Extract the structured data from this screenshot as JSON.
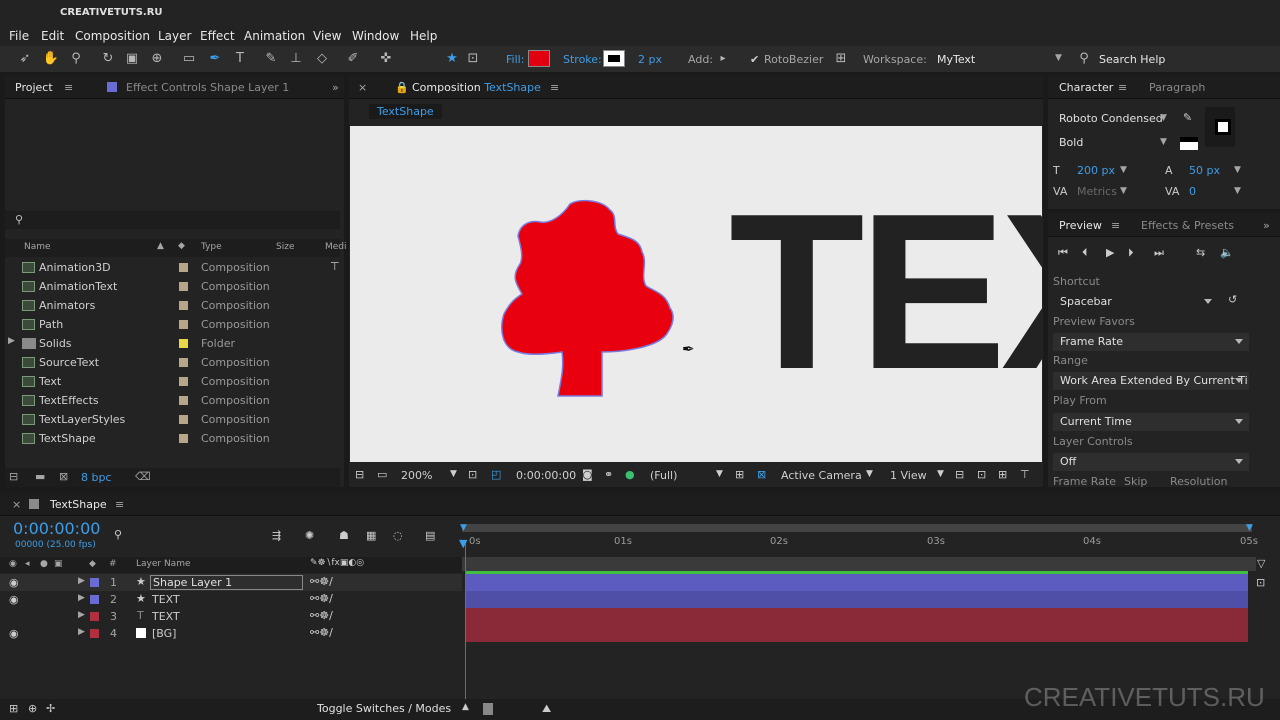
{
  "app": {
    "title": "CREATIVETUTS.RU",
    "watermark": "CREATIVETUTS.RU"
  },
  "menu": [
    "File",
    "Edit",
    "Composition",
    "Layer",
    "Effect",
    "Animation",
    "View",
    "Window",
    "Help"
  ],
  "toolbar": {
    "fill_label": "Fill:",
    "fill_color": "#e00010",
    "stroke_label": "Stroke:",
    "stroke_width": "2 px",
    "add_label": "Add:",
    "rotobezier_label": "RotoBezier",
    "workspace_label": "Workspace:",
    "workspace_value": "MyText",
    "search_placeholder": "Search Help"
  },
  "project": {
    "tab": "Project",
    "effect_tab": "Effect Controls Shape Layer 1",
    "search_icon": "search-icon",
    "columns": [
      "Name",
      "Type",
      "Size",
      "Medi"
    ],
    "items": [
      {
        "name": "Animation3D",
        "type": "Composition"
      },
      {
        "name": "AnimationText",
        "type": "Composition"
      },
      {
        "name": "Animators",
        "type": "Composition"
      },
      {
        "name": "Path",
        "type": "Composition"
      },
      {
        "name": "Solids",
        "type": "Folder"
      },
      {
        "name": "SourceText",
        "type": "Composition"
      },
      {
        "name": "Text",
        "type": "Composition"
      },
      {
        "name": "TextEffects",
        "type": "Composition"
      },
      {
        "name": "TextLayerStyles",
        "type": "Composition"
      },
      {
        "name": "TextShape",
        "type": "Composition"
      }
    ],
    "bpc": "8 bpc"
  },
  "composition": {
    "tab_prefix": "Composition",
    "tab_name": "TextShape",
    "subtab": "TextShape",
    "canvas_text": "TEX",
    "zoom": "200%",
    "timecode": "0:00:00:00",
    "resolution": "(Full)",
    "camera": "Active Camera",
    "view": "1 View"
  },
  "character": {
    "tab": "Character",
    "tab2": "Paragraph",
    "font": "Roboto Condensed",
    "style": "Bold",
    "size": "200 px",
    "leading": "50 px",
    "kerning": "Metrics",
    "tracking": "0"
  },
  "preview": {
    "tab": "Preview",
    "tab2": "Effects & Presets",
    "shortcut_label": "Shortcut",
    "shortcut": "Spacebar",
    "favors_label": "Preview Favors",
    "favors": "Frame Rate",
    "range_label": "Range",
    "range": "Work Area Extended By Current Ti",
    "playfrom_label": "Play From",
    "playfrom": "Current Time",
    "layerctrl_label": "Layer Controls",
    "layerctrl": "Off",
    "footer": [
      "Frame Rate",
      "Skip",
      "Resolution"
    ]
  },
  "timeline": {
    "tab": "TextShape",
    "timecode": "0:00:00:00",
    "fps": "00000 (25.00 fps)",
    "col_layer": "Layer Name",
    "layers": [
      {
        "num": "1",
        "name": "Shape Layer 1",
        "color": "#6b6bd6",
        "icon": "star"
      },
      {
        "num": "2",
        "name": "TEXT",
        "color": "#6b6bd6",
        "icon": "star"
      },
      {
        "num": "3",
        "name": "TEXT",
        "color": "#b03040",
        "icon": "T"
      },
      {
        "num": "4",
        "name": "[BG]",
        "color": "#b03040",
        "icon": "box"
      }
    ],
    "ruler": [
      "0s",
      "01s",
      "02s",
      "03s",
      "04s",
      "05s"
    ],
    "toggle_label": "Toggle Switches / Modes"
  }
}
